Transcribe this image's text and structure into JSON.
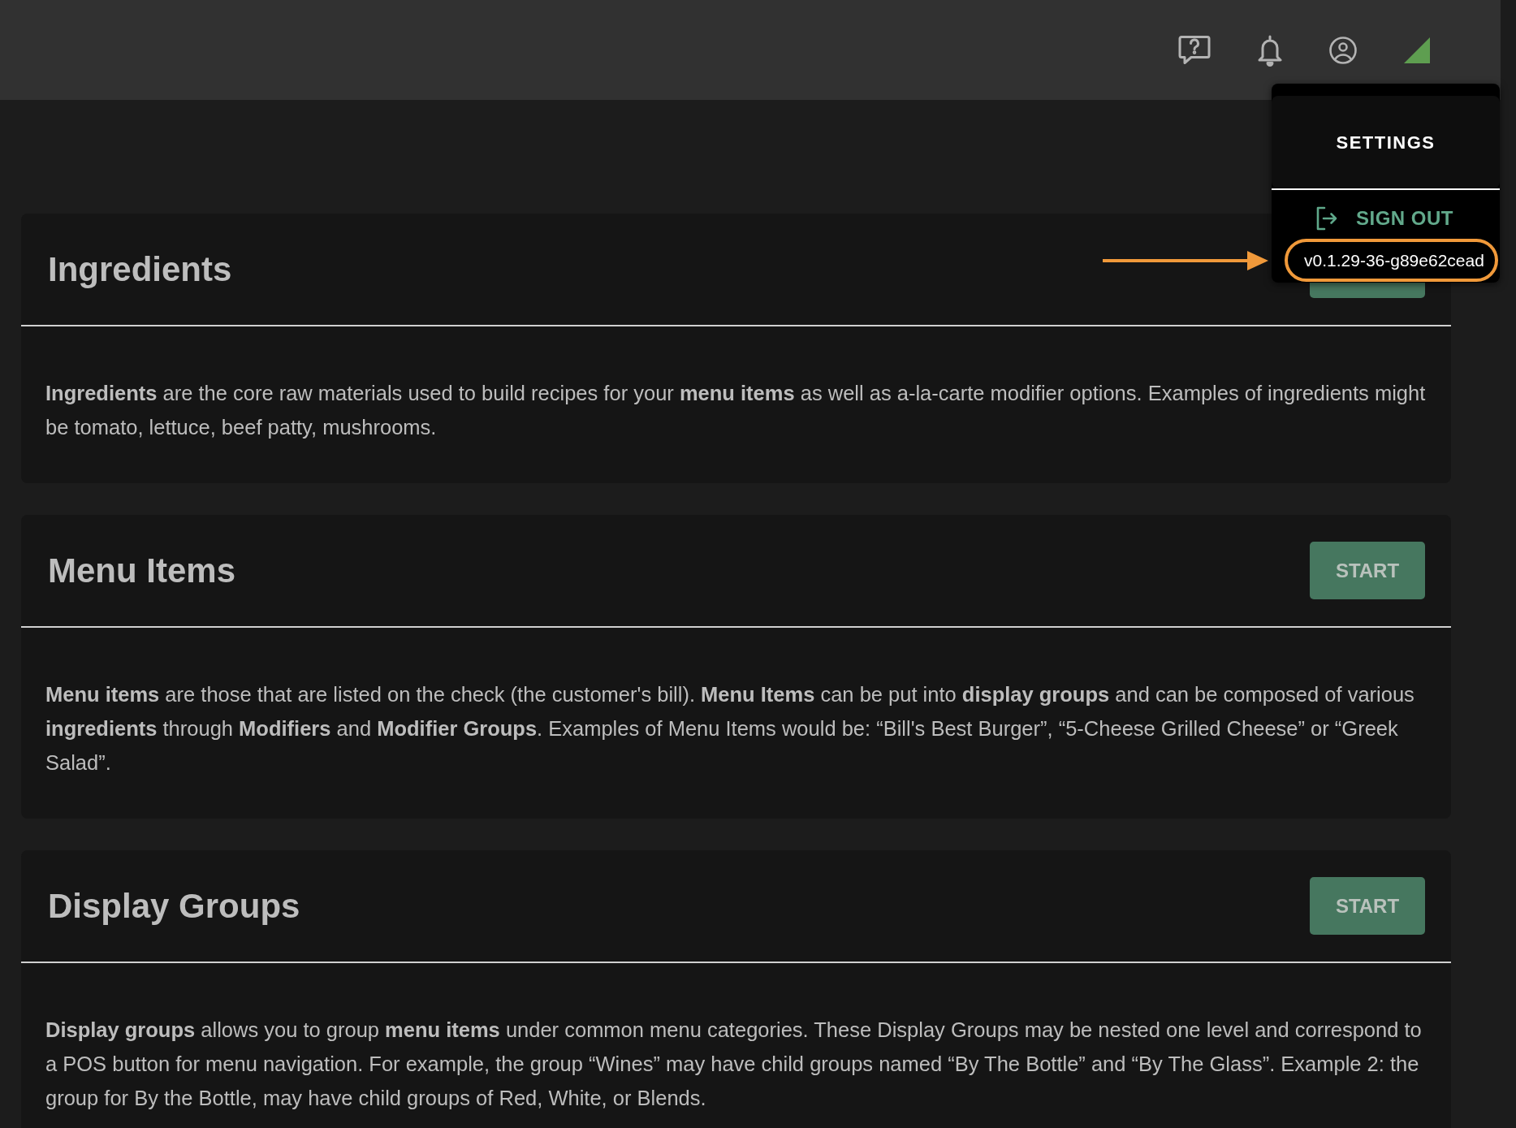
{
  "settings_menu": {
    "title": "SETTINGS",
    "items": [
      {
        "label": "SIGN OUT"
      }
    ],
    "version": {
      "text": "v0.1.29-36-g89e62cead",
      "highlighted": true
    }
  },
  "cards": [
    {
      "title": "Ingredients",
      "has_button": true,
      "description": "**Ingredients** are the core raw materials used to build recipes for your **menu items** as well as a-la-carte modifier options. Examples of ingredients might be tomato, lettuce, beef patty, mushrooms."
    },
    {
      "title": "Menu Items",
      "has_button": true,
      "button_label": "START",
      "description": "**Menu items** are those that are listed on the check (the customer's bill). **Menu Items** can be put into **display groups** and can be composed of various **ingredients** through **Modifiers** and **Modifier Groups**. Examples of Menu Items would be: “Bill's Best Burger”, “5-Cheese Grilled Cheese” or “Greek Salad”."
    },
    {
      "title": "Display Groups",
      "has_button": true,
      "button_label": "START",
      "description": "**Display groups** allows you to group **menu items** under common menu categories. These Display Groups may be nested one level and correspond to a POS button for menu navigation. For example, the group “Wines” may have child groups named “By The Bottle” and “By The Glass”. Example 2: the group for By the Bottle, may have child groups of Red, White, or Blends."
    }
  ]
}
